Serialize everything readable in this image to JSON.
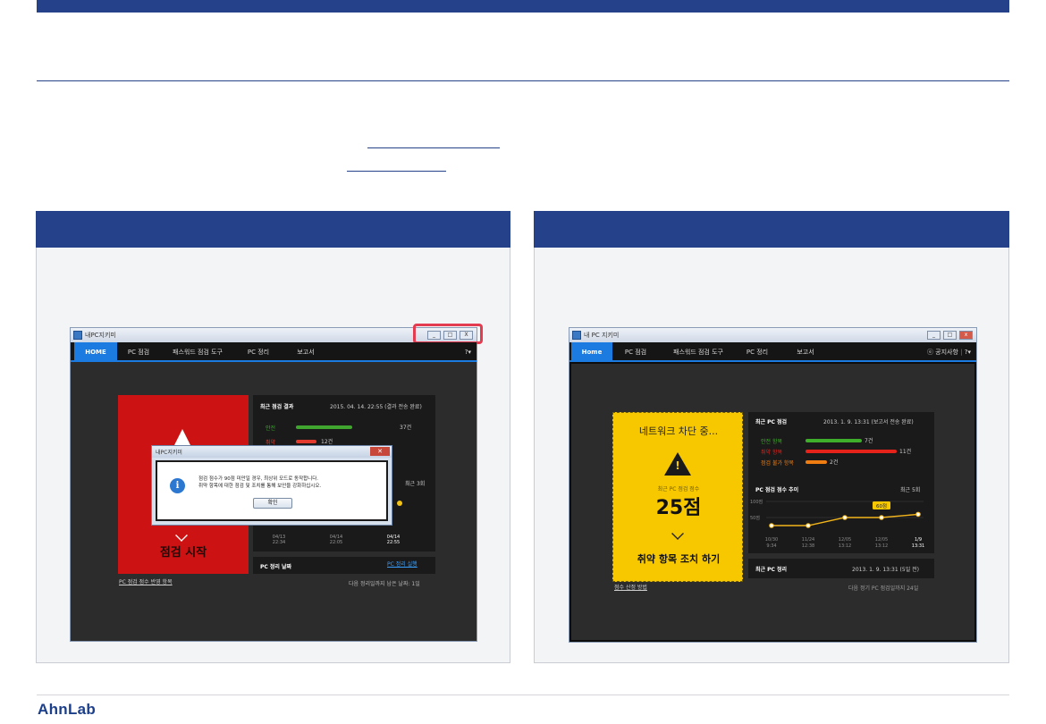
{
  "brand": {
    "logo": "AhnLab"
  },
  "left_app": {
    "window_title": "내PC지키미",
    "controls": {
      "minimize": "_",
      "maximize": "□",
      "close": "X"
    },
    "tabs": [
      "HOME",
      "PC 점검",
      "패스워드 점검 도구",
      "PC 정리",
      "보고서"
    ],
    "help": "?▾",
    "status_text": "점검 시작",
    "recent_check_title": "최근 점검 결과",
    "recent_check_time": "2015. 04. 14. 22:55 (결과 전송 완료)",
    "rows": [
      {
        "label": "안전",
        "count": "37건",
        "color": "#3fa52f",
        "fraction": 0.55
      },
      {
        "label": "취약",
        "count": "12건",
        "color": "#e23b2e",
        "fraction": 0.2
      }
    ],
    "trend_label": "최근 3회",
    "x_ticks": [
      {
        "date": "04/13",
        "time": "22:34"
      },
      {
        "date": "04/14",
        "time": "22:05"
      },
      {
        "date": "04/14",
        "time": "22:55"
      }
    ],
    "cleanup_title": "PC 정리 날짜",
    "cleanup_link": "PC 정리 실행",
    "left_link": "PC 점검 점수 반영 항목",
    "next_cleanup": "다음 정리일까지 남은 날짜: 1일",
    "dialog": {
      "title": "내PC지키미",
      "line1": "점검 점수가 90점 미만일 경우, 최상위 모드로 동작합니다.",
      "line2": "취약 항목에 대한 점검 및 조치를 통해 보안을 강화하십시오.",
      "ok": "확인"
    }
  },
  "right_app": {
    "window_title": "내 PC 지키미",
    "tabs": [
      "Home",
      "PC 점검",
      "패스워드 점검 도구",
      "PC 정리",
      "보고서"
    ],
    "notice": "공지사항",
    "help": "?▾",
    "network_status": "네트워크 차단 중...",
    "score_label": "최근 PC 점검 점수",
    "score": "25점",
    "action": "취약 항목 조치 하기",
    "recent_check_title": "최근 PC 점검",
    "recent_check_time": "2013. 1. 9. 13:31 (보고서 전송 완료)",
    "rows": [
      {
        "label": "안전 항목",
        "count": "7건",
        "color": "#3fae2a",
        "fraction": 0.42
      },
      {
        "label": "취약 항목",
        "count": "11건",
        "color": "#e5231b",
        "fraction": 0.68
      },
      {
        "label": "점검 불가 항목",
        "count": "2건",
        "color": "#f07d12",
        "fraction": 0.16
      }
    ],
    "trend_title": "PC 점검 점수 추이",
    "trend_range": "최근 5회",
    "y_labels": [
      "100점",
      "50점"
    ],
    "points": [
      {
        "date": "10/30",
        "time": "9:34",
        "score": 25
      },
      {
        "date": "11/24",
        "time": "12:38",
        "score": 25
      },
      {
        "date": "12/05",
        "time": "13:12",
        "score": 50
      },
      {
        "date": "12/05",
        "time": "13:12",
        "score": 50
      },
      {
        "date": "1/9",
        "time": "13:31",
        "score": 60
      }
    ],
    "highlight_point": "60점",
    "recent_cleanup_title": "최근 PC 정리",
    "recent_cleanup_time": "2013. 1. 9. 13:31 (5일 전)",
    "left_link": "점수 산정 방법",
    "next_check": "다음 정기 PC 점검일까지 24일"
  }
}
